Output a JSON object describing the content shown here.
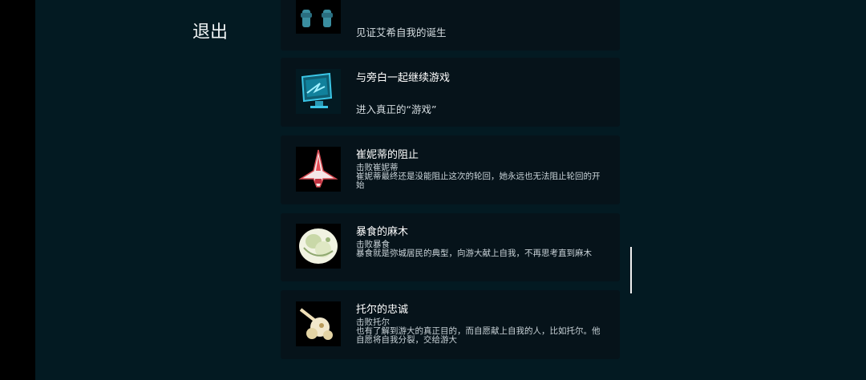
{
  "exit_label": "退出",
  "achievements": [
    {
      "title": "",
      "subtitle": "见证艾希自我的诞生",
      "detail": "",
      "icon": "twin-figures-icon"
    },
    {
      "title": "与旁白一起继续游戏",
      "subtitle": "进入真正的“游戏”",
      "detail": "",
      "icon": "computer-monitor-icon"
    },
    {
      "title": "崔妮蒂的阻止",
      "subtitle": "击败崔妮蒂",
      "detail": "崔妮蒂最终还是没能阻止这次的轮回，她永远也无法阻止轮回的开始",
      "icon": "spaceship-icon"
    },
    {
      "title": "暴食的麻木",
      "subtitle": "击败暴食",
      "detail": "暴食就是弥城居民的典型，向游大献上自我，不再思考直到麻木",
      "icon": "gluttony-blob-icon"
    },
    {
      "title": "托尔的忠诚",
      "subtitle": "击败托尔",
      "detail": "也有了解到游大的真正目的，而自愿献上自我的人，比如托尔。他自愿将自我分裂，交给游大",
      "icon": "thor-creature-icon"
    }
  ]
}
